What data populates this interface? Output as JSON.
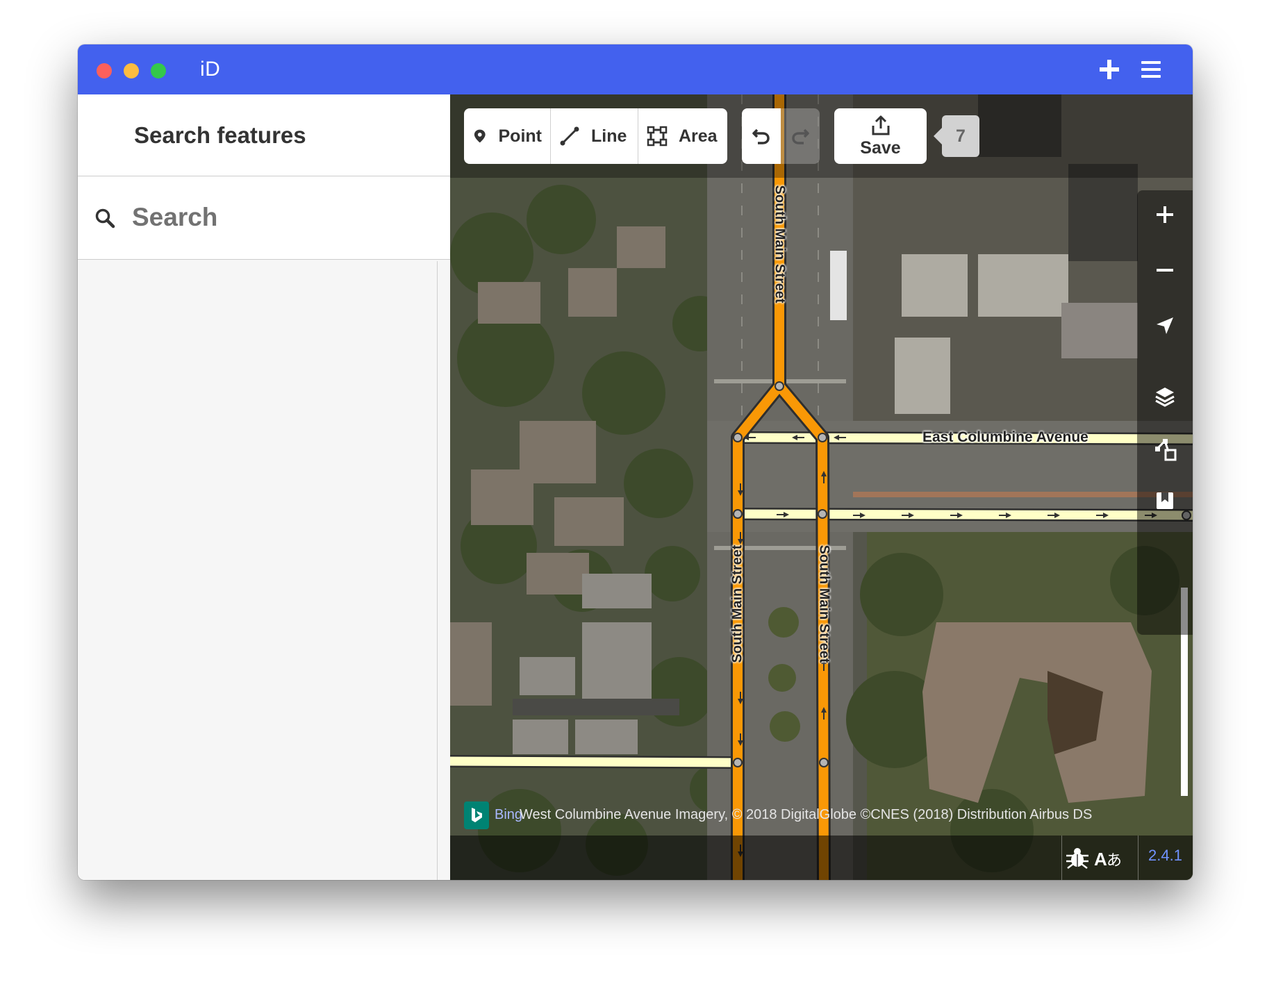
{
  "window": {
    "app_title": "iD",
    "titlebar_color": "#4361ee"
  },
  "titlebar_buttons": {
    "add_icon": "plus-icon",
    "menu_icon": "hamburger-menu-icon"
  },
  "sidebar": {
    "title": "Search features",
    "search": {
      "placeholder": "Search",
      "value": "",
      "icon": "search-icon"
    }
  },
  "toolbar": {
    "modes": [
      {
        "label": "Point",
        "icon": "map-pin-icon"
      },
      {
        "label": "Line",
        "icon": "line-icon"
      },
      {
        "label": "Area",
        "icon": "area-icon"
      }
    ],
    "undo_icon": "undo-icon",
    "redo_icon": "redo-icon",
    "save_label": "Save",
    "save_icon": "upload-icon",
    "edit_count": "7"
  },
  "map_controls": [
    "zoom-in-icon",
    "zoom-out-icon",
    "geolocate-icon",
    "layers-icon",
    "map-data-icon",
    "help-icon"
  ],
  "map_labels": {
    "south_main_north": "South Main Street",
    "south_main_sw": "South Main Street",
    "south_main_se": "South Main Street",
    "east_columbine": "East Columbine Avenue",
    "west_columbine": "West Columbine Avenue"
  },
  "colors": {
    "road_primary": "#f99806",
    "road_residential": "#ffffc7",
    "accent": "#7092ff"
  },
  "attribution": {
    "bing_link": "Bing",
    "text": "West Columbine Avenue Imagery, © 2018 DigitalGlobe ©CNES (2018) Distribution Airbus DS"
  },
  "footer": {
    "issues_icon": "bug-icon",
    "translate_icon": "translate-icon",
    "version": "2.4.1"
  }
}
